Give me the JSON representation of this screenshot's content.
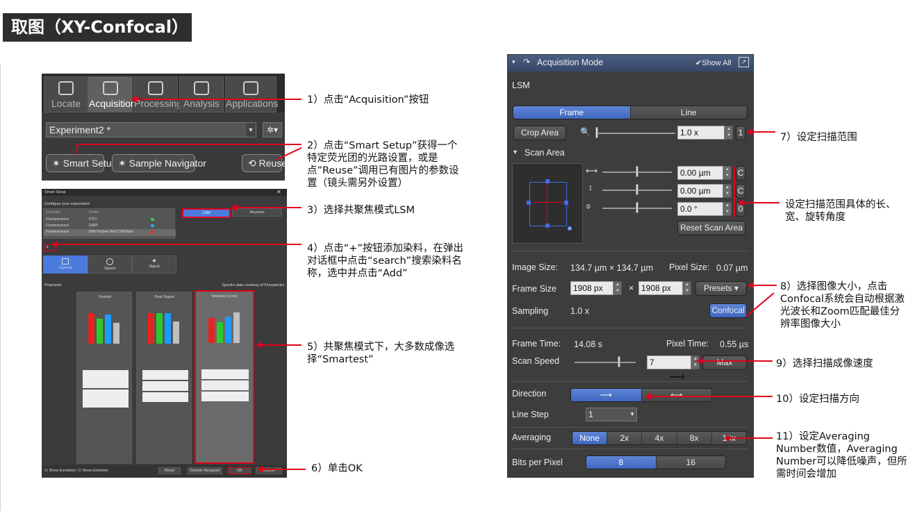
{
  "page_title": "取图（XY-Confocal）",
  "zen": {
    "tabs": [
      {
        "label": "Locate",
        "icon": "locate-icon"
      },
      {
        "label": "Acquisition",
        "icon": "acquisition-icon"
      },
      {
        "label": "Processing",
        "icon": "processing-icon"
      },
      {
        "label": "Analysis",
        "icon": "analysis-icon"
      },
      {
        "label": "Applications",
        "icon": "applications-icon"
      }
    ],
    "experiment_value": "Experiment2 *",
    "smart_setup_label": "Smart Setup",
    "sample_navigator_label": "Sample Navigator",
    "reuse_label": "Reuse"
  },
  "smart_setup": {
    "window_title": "Smart Setup",
    "configure_label": "Configure your experiment",
    "col_contrast": "Contrast",
    "col_probe": "Probe",
    "rows": [
      {
        "contrast": "Fluorescence",
        "probe": "FITC"
      },
      {
        "contrast": "Fluorescence",
        "probe": "DAPI"
      },
      {
        "contrast": "Fluorescence",
        "probe": "MitoTracker Red CMXRos"
      }
    ],
    "mode_lsm": "LSM",
    "mode_airyscan": "Airyscan",
    "tabs": [
      "Current",
      "Speed",
      "Signal"
    ],
    "proposals_label": "Proposals",
    "spectra_credit": "Spectra data courtesy of Fluospectra",
    "proposals": [
      "Fastest",
      "Best Signal",
      "Smartest (Line)"
    ],
    "show_excitation": "Show Excitation",
    "show_emission": "Show Emission",
    "reset_label": "Reset",
    "sample_nav_label": "Sample Navigator",
    "ok_label": "OK",
    "cancel_label": "Cancel"
  },
  "acq": {
    "header_title": "Acquisition Mode",
    "show_all": "Show All",
    "lsm_label": "LSM",
    "frame_label": "Frame",
    "line_label": "Line",
    "crop_area": "Crop Area",
    "zoom_value": "1.0 x",
    "zoom_reset": "1",
    "scan_area_label": "Scan Area",
    "offset_x": "0.00 µm",
    "offset_y": "0.00 µm",
    "rotation": "0.0 °",
    "reset_x": "C",
    "reset_y": "C",
    "reset_rot": "0",
    "reset_scan_area": "Reset Scan Area",
    "image_size_label": "Image Size:",
    "image_size_value": "134.7 µm × 134.7 µm",
    "pixel_size_label": "Pixel Size:",
    "pixel_size_value": "0.07 µm",
    "frame_size_label": "Frame Size",
    "frame_w": "1908 px",
    "times": "×",
    "frame_h": "1908 px",
    "presets": "Presets ▾",
    "sampling_label": "Sampling",
    "sampling_value": "1.0 x",
    "confocal_btn": "Confocal",
    "frame_time_label": "Frame Time:",
    "frame_time_value": "14.08 s",
    "pixel_time_label": "Pixel Time:",
    "pixel_time_value": "0.55 µs",
    "scan_speed_label": "Scan Speed",
    "scan_speed_value": "7",
    "max_btn": "Max",
    "direction_label": "Direction",
    "line_step_label": "Line Step",
    "line_step_value": "1",
    "averaging_label": "Averaging",
    "averaging_options": [
      "None",
      "2x",
      "4x",
      "8x",
      "16x"
    ],
    "bits_label": "Bits per Pixel",
    "bits_options": [
      "8",
      "16"
    ]
  },
  "notes": {
    "n1": "1）点击“Acquisition”按钮",
    "n2": "2）点击“Smart Setup”获得一个特定荧光团的光路设置，或是点”Reuse”调用已有图片的参数设置（镜头需另外设置）",
    "n3": "3）选择共聚焦模式LSM",
    "n4": "4）点击“+”按钮添加染料，在弹出对话框中点击“search”搜索染料名称，选中并点击“Add”",
    "n5": "5）共聚焦模式下，大多数成像选择“Smartest”",
    "n6": "6）单击OK",
    "n7": "7）设定扫描范围",
    "n7b": "设定扫描范围具体的长、宽、旋转角度",
    "n8": "8）选择图像大小，点击Confocal系统会自动根据激光波长和Zoom匹配最佳分辨率图像大小",
    "n9": "9）选择扫描成像速度",
    "n10": "10）设定扫描方向",
    "n11": "11）设定Averaging Number数值，Averaging Number可以降低噪声，但所需时间会增加"
  },
  "colors": {
    "accent": "#e3001b",
    "selected_blue": "#4f76cc"
  }
}
